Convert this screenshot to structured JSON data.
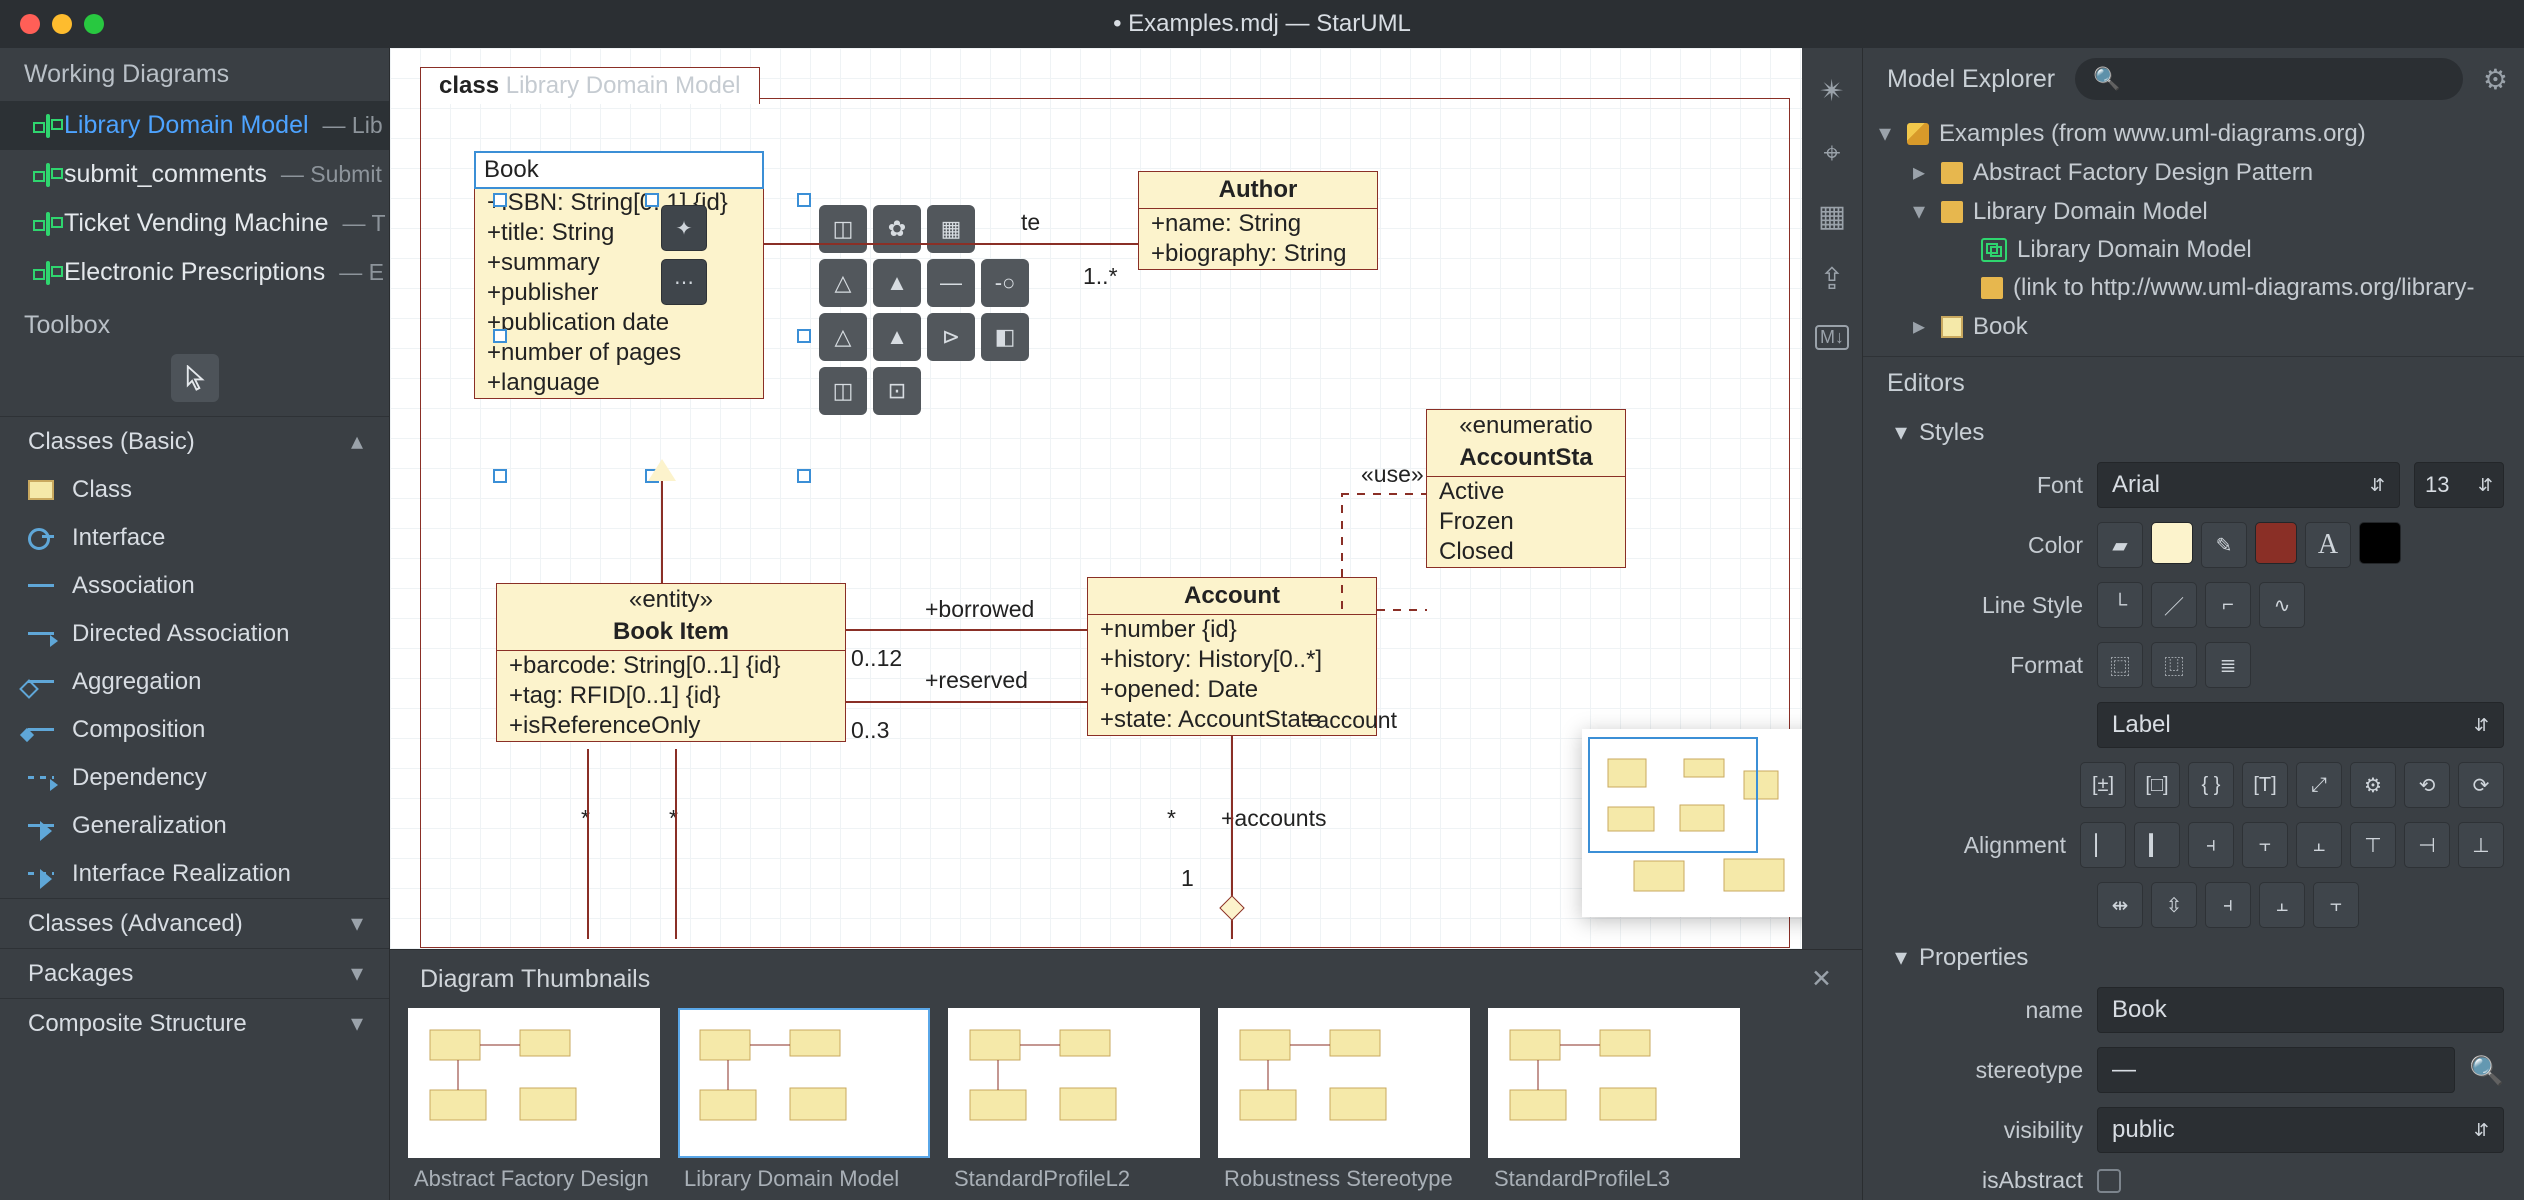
{
  "title": "• Examples.mdj — StarUML",
  "left": {
    "workingDiagrams": "Working Diagrams",
    "diagrams": [
      {
        "name": "Library Domain Model",
        "sub": "— Lib",
        "sel": true
      },
      {
        "name": "submit_comments",
        "sub": "— Submit",
        "sel": false
      },
      {
        "name": "Ticket Vending Machine",
        "sub": "— T",
        "sel": false
      },
      {
        "name": "Electronic Prescriptions",
        "sub": "— E",
        "sel": false
      }
    ],
    "toolbox": "Toolbox",
    "groupBasic": "Classes (Basic)",
    "items": [
      "Class",
      "Interface",
      "Association",
      "Directed Association",
      "Aggregation",
      "Composition",
      "Dependency",
      "Generalization",
      "Interface Realization"
    ],
    "groupsCollapsed": [
      "Classes (Advanced)",
      "Packages",
      "Composite Structure"
    ]
  },
  "canvas": {
    "frameType": "class",
    "frameTitle": "Library Domain Model",
    "book": {
      "editValue": "Book",
      "attrs": [
        "+ISBN: String[0..1] {id}",
        "+title: String",
        "+summary",
        "+publisher",
        "+publication date",
        "+number of pages",
        "+language"
      ]
    },
    "author": {
      "name": "Author",
      "attrs": [
        "+name: String",
        "+biography: String"
      ]
    },
    "bookItem": {
      "stereo": "«entity»",
      "name": "Book Item",
      "attrs": [
        "+barcode: String[0..1] {id}",
        "+tag: RFID[0..1] {id}",
        "+isReferenceOnly"
      ]
    },
    "account": {
      "name": "Account",
      "attrs": [
        "+number {id}",
        "+history: History[0..*]",
        "+opened: Date",
        "+state: AccountState"
      ]
    },
    "enum": {
      "stereo": "«enumeratio",
      "name": "AccountSta",
      "lits": [
        "Active",
        "Frozen",
        "Closed"
      ]
    },
    "labels": {
      "wrote": "te",
      "oneMany": "1..*",
      "use": "«use»",
      "borrowed": "+borrowed",
      "b012": "0..12",
      "reserved": "+reserved",
      "b03": "0..3",
      "star1": "*",
      "star2": "*",
      "star3": "*",
      "accounts": "+accounts",
      "one": "1",
      "accountRole": "+account"
    }
  },
  "thumbs": {
    "title": "Diagram Thumbnails",
    "items": [
      "Abstract Factory Design",
      "Library Domain Model",
      "StandardProfileL2",
      "Robustness Stereotype",
      "StandardProfileL3"
    ],
    "sel": 1
  },
  "right": {
    "explorer": "Model Explorer",
    "tree": {
      "root": "Examples (from www.uml-diagrams.org)",
      "n1": "Abstract Factory Design Pattern",
      "n2": "Library Domain Model",
      "n2a": "Library Domain Model",
      "n2b": "(link to http://www.uml-diagrams.org/library-",
      "n2c": "Book"
    },
    "editors": "Editors",
    "styles": "Styles",
    "fontLbl": "Font",
    "fontVal": "Arial",
    "fontSize": "13",
    "colorLbl": "Color",
    "fill": "#fcf3cc",
    "line": "#8a2f26",
    "text": "#000000",
    "lineStyleLbl": "Line Style",
    "formatLbl": "Format",
    "formatVal": "Label",
    "alignLbl": "Alignment",
    "properties": "Properties",
    "nameLbl": "name",
    "nameVal": "Book",
    "stereoLbl": "stereotype",
    "stereoVal": "—",
    "visLbl": "visibility",
    "visVal": "public",
    "absLbl": "isAbstract"
  }
}
